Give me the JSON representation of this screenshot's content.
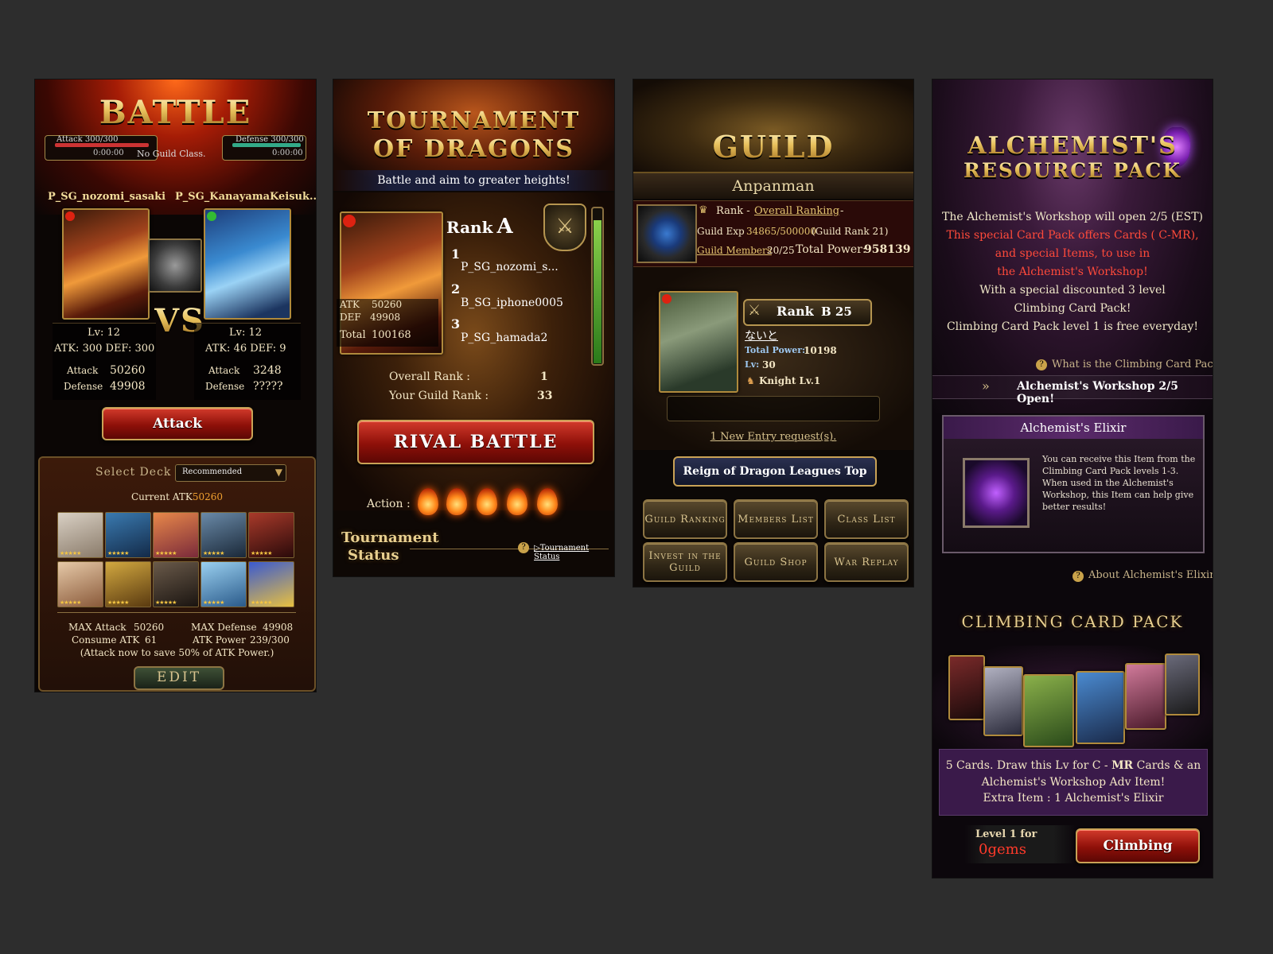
{
  "battle": {
    "title": "BATTLE",
    "attack_gauge_label": "Attack 300/300",
    "defense_gauge_label": "Defense 300/300",
    "attack_timer": "0:00:00",
    "defense_timer": "0:00:00",
    "guild_class": "No Guild Class.",
    "player_name": "P_SG_nozomi_sasaki",
    "opponent_name": "P_SG_KanayamaKeisuk..",
    "vs_label": "VS",
    "player_lv": "Lv: 12",
    "player_atkdef": "ATK: 300  DEF: 300",
    "opponent_lv": "Lv: 12",
    "opponent_atkdef": "ATK: 46  DEF: 9",
    "attack_label": "Attack",
    "defense_label": "Defense",
    "player_attack": "50260",
    "player_defense": "49908",
    "opponent_attack": "3248",
    "opponent_defense": "?????",
    "attack_button": "Attack",
    "select_deck_label": "Select Deck",
    "deck_value": "Recommended",
    "current_atk_label": "Current ATK",
    "current_atk_value": "50260",
    "max_attack_label": "MAX Attack",
    "max_attack_value": "50260",
    "max_defense_label": "MAX Defense",
    "max_defense_value": "49908",
    "consume_atk_label": "Consume ATK",
    "consume_atk_value": "61",
    "atk_power_label": "ATK Power",
    "atk_power_value": "239/300",
    "note": "(Attack now to save 50% of ATK Power.)",
    "edit_button": "EDIT"
  },
  "tournament": {
    "title_line1": "TOURNAMENT",
    "title_line2": "OF DRAGONS",
    "subtitle": "Battle and aim to greater heights!",
    "rank_label": "Rank",
    "rank_value": "A",
    "atk_label": "ATK",
    "atk_value": "50260",
    "def_label": "DEF",
    "def_value": "49908",
    "total_label": "Total",
    "total_value": "100168",
    "ranking": [
      {
        "pos": "1",
        "name": "P_SG_nozomi_s..."
      },
      {
        "pos": "2",
        "name": "B_SG_iphone0005"
      },
      {
        "pos": "3",
        "name": "P_SG_hamada2"
      }
    ],
    "overall_rank_label": "Overall Rank :",
    "overall_rank_value": "1",
    "guild_rank_label": "Your Guild Rank :",
    "guild_rank_value": "33",
    "rival_button": "RIVAL BATTLE",
    "action_label": "Action :",
    "status_title_1": "Tournament",
    "status_title_2": "Status",
    "status_link": "▷Tournament Status"
  },
  "guild": {
    "title": "GUILD",
    "guild_name": "Anpanman",
    "rank_label": "Rank -",
    "overall_ranking_link": "Overall Ranking",
    "rank_dash": "-",
    "guild_exp_label": "Guild Exp",
    "guild_exp_value": "34865/500000",
    "guild_rank_note": "(Guild Rank 21)",
    "members_link": "Guild Members",
    "members_value": "20/25",
    "total_power_label": "Total Power:",
    "total_power_value": "958139",
    "leader_rank_label": "Rank",
    "leader_rank_value": "B 25",
    "leader_name": "ないと",
    "leader_power_label": "Total Power:",
    "leader_power_value": "10198",
    "leader_lv_label": "Lv:",
    "leader_lv_value": "30",
    "leader_class": "Knight Lv.1",
    "entry_request": "1 New Entry request(s).",
    "reign_button": "Reign of Dragon Leagues Top",
    "buttons": [
      "Guild Ranking",
      "Members List",
      "Class List",
      "Invest in the Guild",
      "Guild Shop",
      "War Replay"
    ]
  },
  "alchemist": {
    "title_line1": "ALCHEMIST'S",
    "title_line2": "RESOURCE PACK",
    "intro": [
      "The Alchemist's Workshop will open 2/5 (EST)",
      "This special Card Pack offers Cards ( C-MR),",
      "and special Items, to use in",
      "the Alchemist's Workshop!",
      "With a special discounted 3 level",
      "Climbing Card Pack!",
      "Climbing Card Pack level 1 is free everyday!"
    ],
    "what_is_link": "What is the Climbing Card Pack",
    "workshop_banner": "Alchemist's Workshop 2/5 Open!",
    "elixir_title": "Alchemist's Elixir",
    "elixir_desc": "You can receive this Item from the Climbing Card Pack levels 1-3. When used in the Alchemist's Workshop, this Item can help give better results!",
    "about_link": "About Alchemist's Elixir",
    "climbing_title": "CLIMBING CARD PACK",
    "pack_line1_a": "5 Cards. Draw this Lv for C - ",
    "pack_line1_b": "MR",
    "pack_line1_c": " Cards & an",
    "pack_line2": "Alchemist's Workshop Adv Item!",
    "pack_line3": "Extra Item : 1 Alchemist's Elixir",
    "level_label": "Level 1 for",
    "price": "0gems",
    "climbing_button": "Climbing"
  },
  "colors": {
    "background": "#2d2d2d",
    "gold": "#e8cf8f",
    "accent_red": "#ff4a3a",
    "button_red": "#8e1009"
  }
}
